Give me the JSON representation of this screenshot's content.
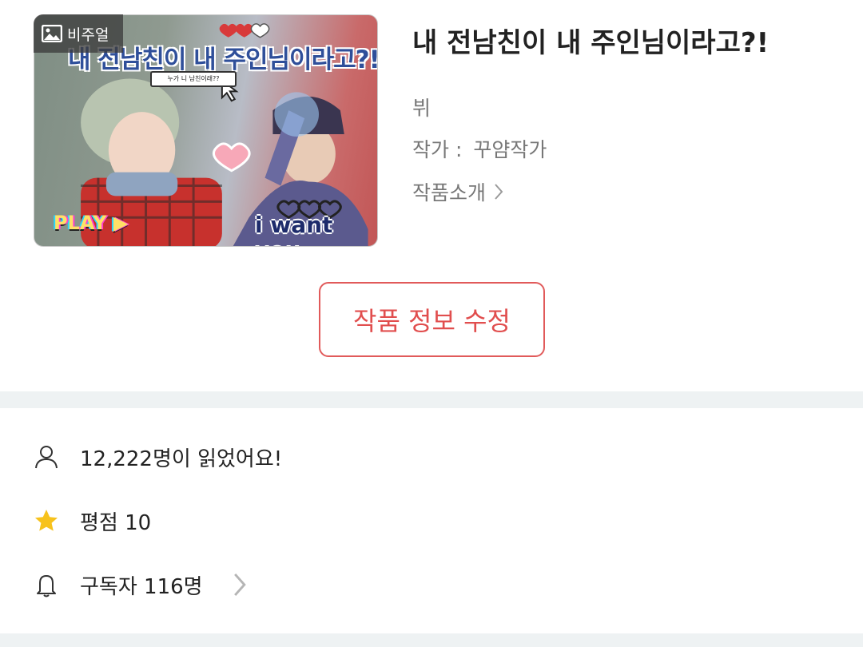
{
  "cover": {
    "badge_label": "비주얼",
    "title_text": "내 전남친이 내 주인님이라고?!",
    "bubble_text": "누가 니 남친이래??",
    "play_text": "PLAY ▶",
    "want_text": "i want you"
  },
  "work": {
    "title": "내 전남친이 내 주인님이라고?!",
    "genre": "뷔",
    "author_label": "작가 :",
    "author_name": "꾸얌작가",
    "intro_label": "작품소개"
  },
  "actions": {
    "edit_label": "작품 정보 수정"
  },
  "stats": {
    "reads": "12,222명이 읽었어요!",
    "rating": "평점 10",
    "subscribers": "구독자 116명"
  },
  "colors": {
    "accent": "#e15a5a",
    "star": "#f7c21c",
    "divider": "#eef2f3"
  },
  "icons": {
    "badge": "image-icon",
    "intro": "chevron-right-icon",
    "reads": "person-icon",
    "rating": "star-icon",
    "subscribers": "bell-icon"
  }
}
